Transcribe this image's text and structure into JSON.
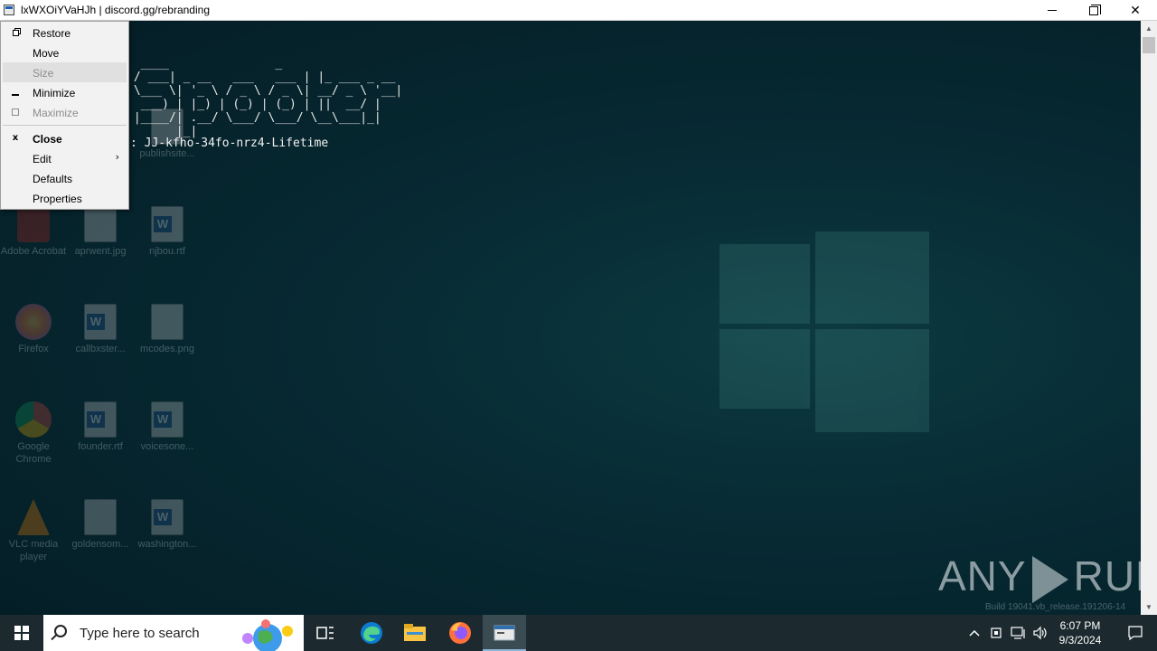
{
  "window": {
    "title": "lxWXOiYVaHJh | discord.gg/rebranding",
    "controls": {
      "minimize": "minimize-icon",
      "maximize": "restore-icon",
      "close": "close-icon"
    }
  },
  "console": {
    "ascii_art": "  ____               _                \n / ___| _ __   ___   ___ | |_ ___ _ __ \n \\___ \\| '_ \\ / _ \\ / _ \\| __/ _ \\ '__|\n  ___) | |_) | (_) | (_) | ||  __/ |   \n |____/| .__/ \\___/ \\___/ \\__\\___|_|   \n       |_|                             ",
    "key_line": ": JJ-kfho-34fo-nrz4-Lifetime"
  },
  "system_menu": {
    "items": [
      {
        "label": "Restore",
        "icon": "restore-icon",
        "enabled": true
      },
      {
        "label": "Move",
        "icon": "",
        "enabled": true
      },
      {
        "label": "Size",
        "icon": "",
        "enabled": false
      },
      {
        "label": "Minimize",
        "icon": "minimize-icon",
        "enabled": true
      },
      {
        "label": "Maximize",
        "icon": "maximize-icon",
        "enabled": false
      },
      {
        "label": "Close",
        "icon": "x",
        "enabled": true
      },
      {
        "label": "Edit",
        "icon": "",
        "enabled": true,
        "submenu": true
      },
      {
        "label": "Defaults",
        "icon": "",
        "enabled": true
      },
      {
        "label": "Properties",
        "icon": "",
        "enabled": true
      }
    ],
    "close_glyph": "x",
    "submenu_glyph": "›"
  },
  "desktop_icons": [
    {
      "label": "Adobe Acrobat"
    },
    {
      "label": "aprwent.jpg"
    },
    {
      "label": "njbou.rtf"
    },
    {
      "label": "Firefox"
    },
    {
      "label": "callbxster..."
    },
    {
      "label": "mcodes.png"
    },
    {
      "label": "Google Chrome"
    },
    {
      "label": "founder.rtf"
    },
    {
      "label": "voicesone..."
    },
    {
      "label": "VLC media player"
    },
    {
      "label": "goldensom..."
    },
    {
      "label": "washington..."
    },
    {
      "label": "publishsite..."
    }
  ],
  "watermark": {
    "brand_left": "ANY",
    "brand_right": "RUN",
    "build": "Build 19041.vb_release.191206-14"
  },
  "taskbar": {
    "search_placeholder": "Type here to search",
    "apps": [
      "task-view-icon",
      "edge-icon",
      "file-explorer-icon",
      "firefox-icon",
      "console-window-icon"
    ],
    "clock_time": "6:07 PM",
    "clock_date": "9/3/2024"
  },
  "colors": {
    "desktop_bg": "#062028",
    "taskbar_bg": "#1c2a2f",
    "menu_bg": "#f2f2f2",
    "menu_disabled": "#8c8c8c"
  }
}
